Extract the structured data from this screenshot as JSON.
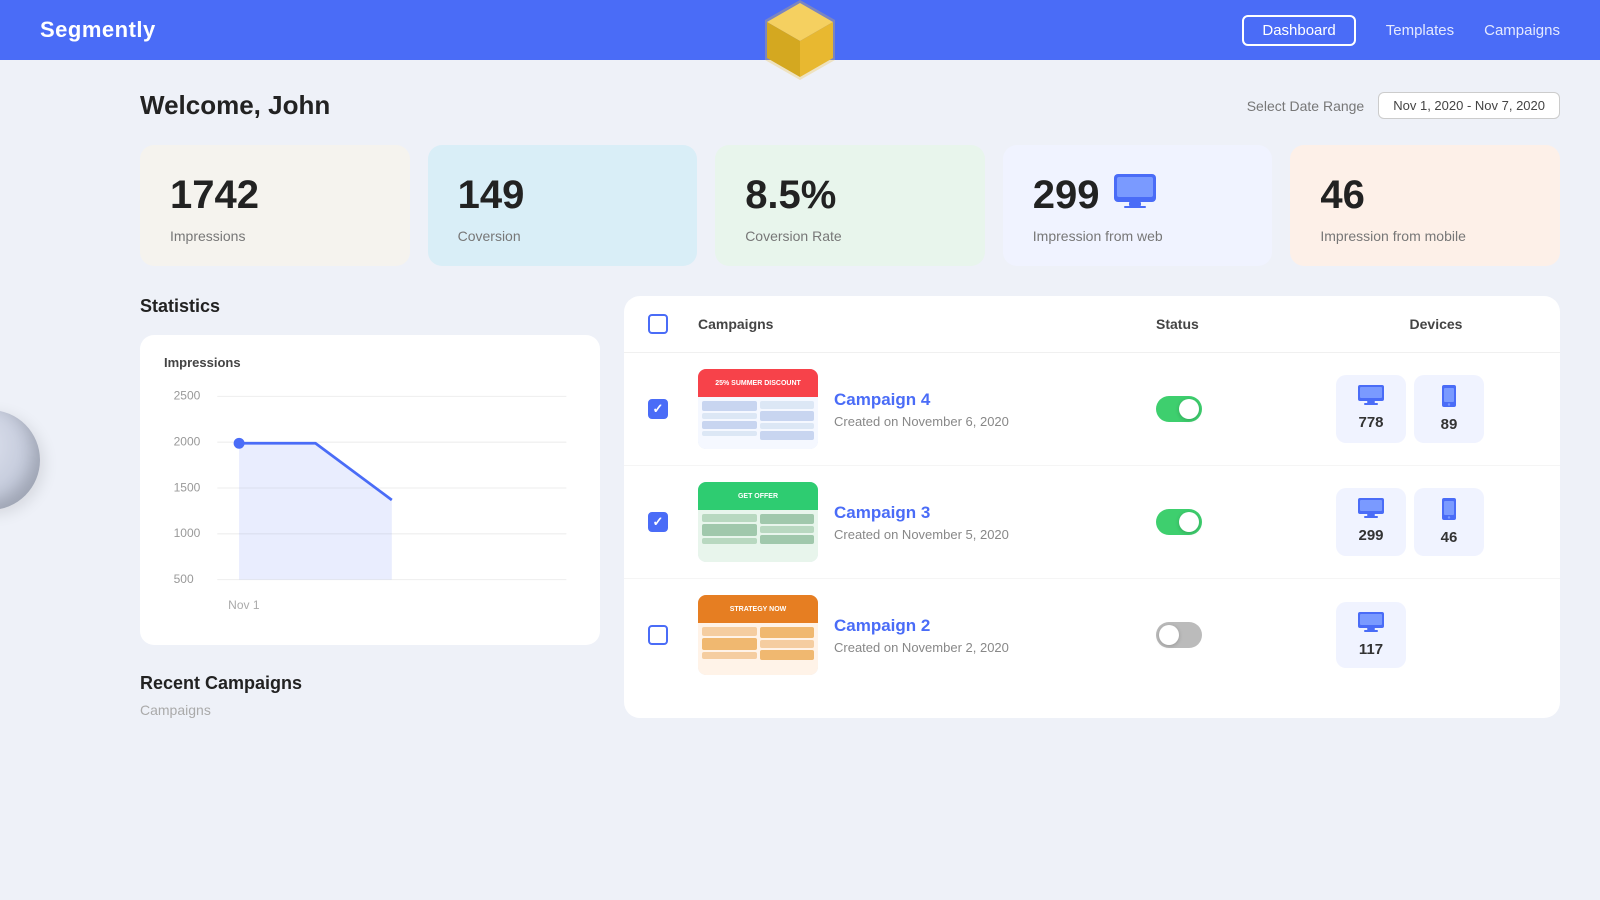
{
  "brand": "Segmently",
  "nav": {
    "dashboard": "Dashboard",
    "templates": "Templates",
    "campaigns": "Campaigns"
  },
  "welcome": "Welcome, John",
  "dateRange": {
    "label": "Select Date Range",
    "value": "Nov 1, 2020 - Nov 7, 2020"
  },
  "kpis": [
    {
      "id": "impressions",
      "value": "1742",
      "label": "Impressions",
      "class": "impressions",
      "icon": null
    },
    {
      "id": "coversion",
      "value": "149",
      "label": "Coversion",
      "class": "coversion",
      "icon": null
    },
    {
      "id": "coversion-rate",
      "value": "8.5%",
      "label": "Coversion Rate",
      "class": "coversion-rate",
      "icon": null
    },
    {
      "id": "web",
      "value": "299",
      "label": "Impression from web",
      "class": "web",
      "icon": "monitor"
    },
    {
      "id": "mobile",
      "value": "46",
      "label": "Impression from mobile",
      "class": "mobile",
      "icon": "monitor"
    }
  ],
  "statistics": {
    "title": "Statistics",
    "chartTitle": "Impressions",
    "yLabels": [
      "2500",
      "2000",
      "1500",
      "1000",
      "500"
    ],
    "xLabel": "Nov 1"
  },
  "recentCampaigns": {
    "title": "Recent Campaigns",
    "sub": "Campaigns"
  },
  "campaigns": {
    "headers": {
      "check": "",
      "name": "Campaigns",
      "status": "Status",
      "devices": "Devices"
    },
    "rows": [
      {
        "id": 1,
        "name": "Campaign 4",
        "date": "Created on November 6, 2020",
        "status": "on",
        "checked": true,
        "thumbColor": "#f7424a",
        "web": 778,
        "mobile": 89
      },
      {
        "id": 2,
        "name": "Campaign 3",
        "date": "Created on November 5, 2020",
        "status": "on",
        "checked": true,
        "thumbColor": "#2ecc71",
        "web": 299,
        "mobile": 46
      },
      {
        "id": 3,
        "name": "Campaign 2",
        "date": "Created on November 2, 2020",
        "status": "off",
        "checked": false,
        "thumbColor": "#e67e22",
        "web": 117,
        "mobile": null
      }
    ]
  }
}
